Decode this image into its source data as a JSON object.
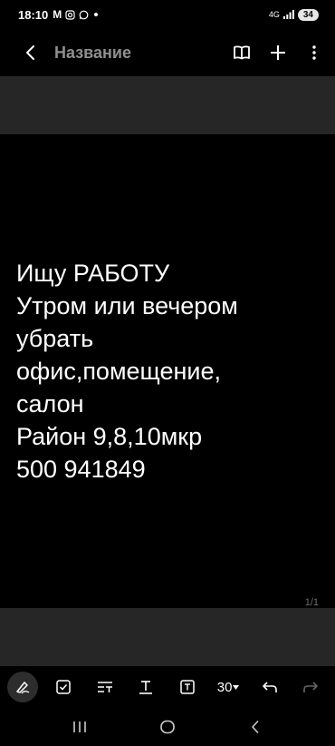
{
  "status_bar": {
    "time": "18:10",
    "left_icons": [
      "M",
      "instagram-icon",
      "whatsapp-icon"
    ],
    "network": "4G",
    "battery": "34"
  },
  "app_bar": {
    "title": "Название"
  },
  "note": {
    "lines": [
      "Ищу РАБОТУ",
      "Утром или вечером",
      "убрать",
      "офис,помещение,",
      "салон",
      "Район 9,8,10мкр",
      "500 941849"
    ],
    "page_indicator": "1/1"
  },
  "toolbar": {
    "font_size": "30"
  },
  "colors": {
    "background": "#000000",
    "band": "#262626",
    "title": "#8f8f8f"
  }
}
